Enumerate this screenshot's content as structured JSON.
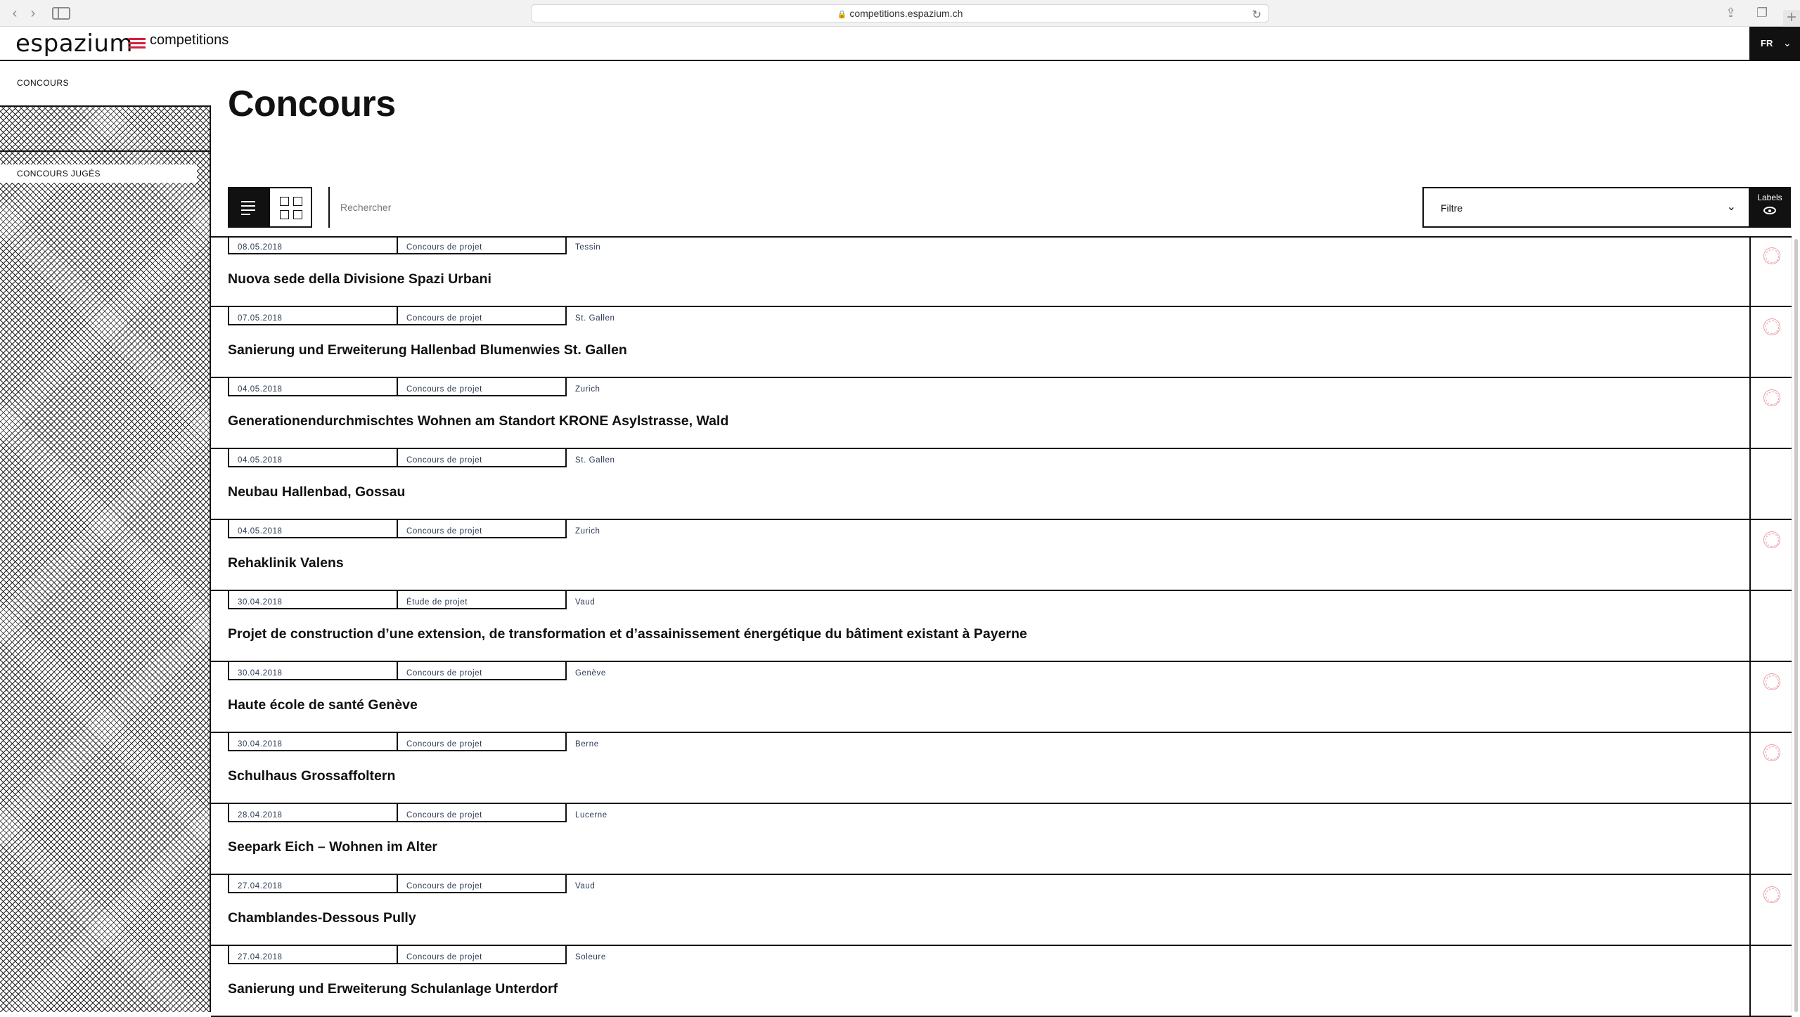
{
  "browser": {
    "url": "competitions.espazium.ch"
  },
  "header": {
    "logo_main": "espazium",
    "logo_sub": "competitions",
    "language": "FR"
  },
  "sidebar": {
    "items": [
      {
        "label": "CONCOURS"
      },
      {
        "label": "CONCOURS JUGÉS"
      }
    ]
  },
  "main": {
    "title": "Concours",
    "search": {
      "placeholder": "Rechercher"
    },
    "filter": {
      "label": "Filtre"
    },
    "labels_button": "Labels"
  },
  "competitions": [
    {
      "date": "08.05.2018",
      "type": "Concours de projet",
      "region": "Tessin",
      "title": "Nuova sede della Divisione Spazi Urbani",
      "label_icon": "sia-label-icon"
    },
    {
      "date": "07.05.2018",
      "type": "Concours de projet",
      "region": "St. Gallen",
      "title": "Sanierung und Erweiterung Hallenbad Blumenwies St. Gallen",
      "label_icon": "sia-label-icon"
    },
    {
      "date": "04.05.2018",
      "type": "Concours de projet",
      "region": "Zurich",
      "title": "Generationendurchmischtes Wohnen am Standort KRONE Asylstrasse, Wald",
      "label_icon": "sia-label-icon"
    },
    {
      "date": "04.05.2018",
      "type": "Concours de projet",
      "region": "St. Gallen",
      "title": "Neubau Hallenbad, Gossau",
      "label_icon": ""
    },
    {
      "date": "04.05.2018",
      "type": "Concours de projet",
      "region": "Zurich",
      "title": "Rehaklinik Valens",
      "label_icon": "sia-label-icon"
    },
    {
      "date": "30.04.2018",
      "type": "Étude de projet",
      "region": "Vaud",
      "title": "Projet de construction d’une extension, de transformation et d’assainissement énergétique du bâtiment existant à Payerne",
      "label_icon": ""
    },
    {
      "date": "30.04.2018",
      "type": "Concours de projet",
      "region": "Genève",
      "title": "Haute école de santé Genève",
      "label_icon": "sia-label-icon"
    },
    {
      "date": "30.04.2018",
      "type": "Concours de projet",
      "region": "Berne",
      "title": "Schulhaus Grossaffoltern",
      "label_icon": "sia-label-icon"
    },
    {
      "date": "28.04.2018",
      "type": "Concours de projet",
      "region": "Lucerne",
      "title": "Seepark Eich – Wohnen im Alter",
      "label_icon": ""
    },
    {
      "date": "27.04.2018",
      "type": "Concours de projet",
      "region": "Vaud",
      "title": "Chamblandes-Dessous Pully",
      "label_icon": "sia-label-icon"
    },
    {
      "date": "27.04.2018",
      "type": "Concours de projet",
      "region": "Soleure",
      "title": "Sanierung und Erweiterung Schulanlage Unterdorf",
      "label_icon": ""
    }
  ],
  "colors": {
    "accent": "#d6213b",
    "meta_text": "#2b3a55",
    "label_icon": "#e58a95"
  }
}
